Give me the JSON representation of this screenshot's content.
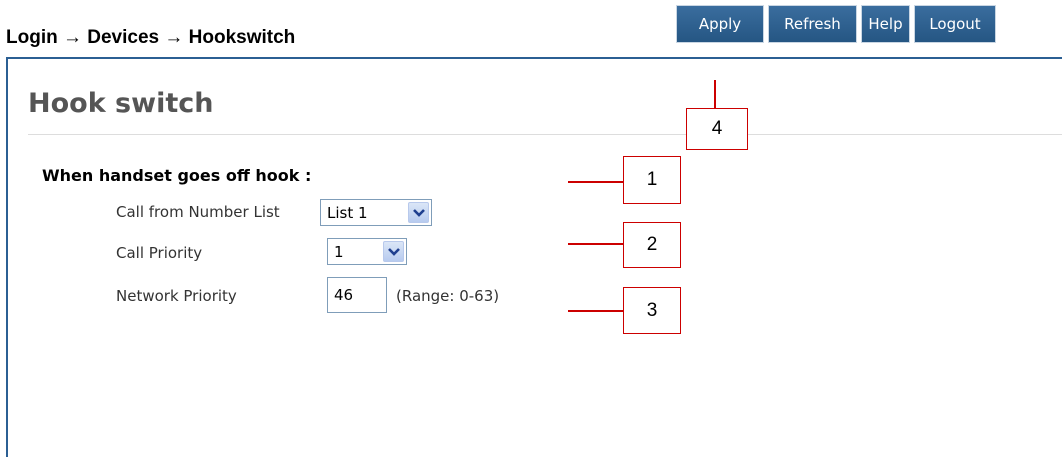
{
  "breadcrumb": "Login → Devices → Hookswitch",
  "toolbar": {
    "apply": "Apply",
    "refresh": "Refresh",
    "help": "Help",
    "logout": "Logout"
  },
  "page": {
    "title": "Hook switch",
    "section_label": "When handset goes off hook :"
  },
  "fields": {
    "call_from_number_list": {
      "label": "Call from Number List",
      "value": "List 1"
    },
    "call_priority": {
      "label": "Call Priority",
      "value": "1"
    },
    "network_priority": {
      "label": "Network Priority",
      "value": "46",
      "range": "(Range: 0-63)"
    }
  },
  "callouts": [
    "1",
    "2",
    "3",
    "4"
  ],
  "colors": {
    "toolbar_button": "#2e6393",
    "panel_border": "#2b5f93",
    "callout_border": "#cc0000"
  }
}
